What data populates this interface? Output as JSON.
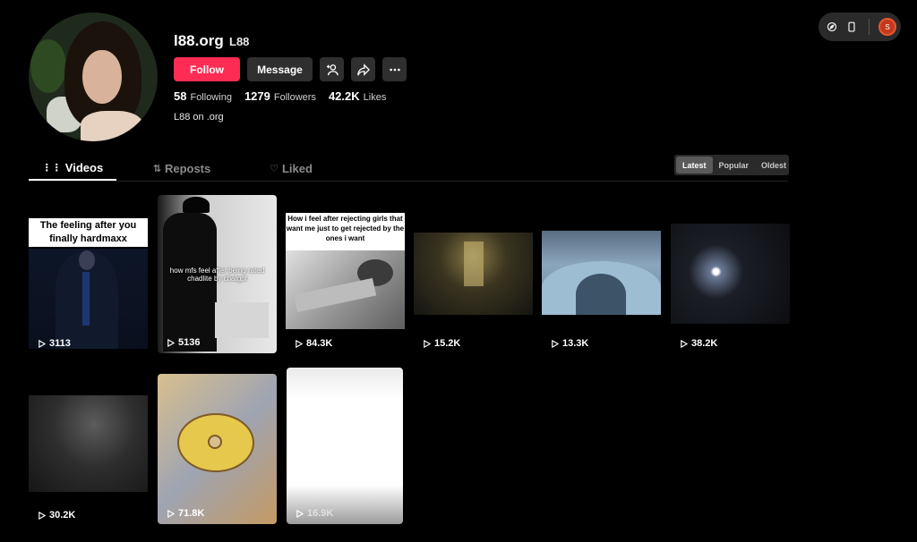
{
  "profile": {
    "handle": "l88.org",
    "nickname": "L88",
    "follow_label": "Follow",
    "message_label": "Message",
    "following_count": "58",
    "following_label": "Following",
    "followers_count": "1279",
    "followers_label": "Followers",
    "likes_count": "42.2K",
    "likes_label": "Likes",
    "bio": "L88 on .org"
  },
  "topbar": {
    "user_initial": "S"
  },
  "tabs": [
    {
      "label": "Videos"
    },
    {
      "label": "Reposts"
    },
    {
      "label": "Liked"
    }
  ],
  "sort": {
    "options": [
      "Latest",
      "Popular",
      "Oldest"
    ],
    "selected": "Latest"
  },
  "videos": [
    {
      "views": "3113",
      "caption": "The feeling after you finally hardmaxx"
    },
    {
      "views": "5136",
      "overlay": "how mfs feel after being rated chadlite by chatgpt"
    },
    {
      "views": "84.3K",
      "caption": "How i feel after rejecting girls that want me just to get rejected by the ones i want"
    },
    {
      "views": "15.2K"
    },
    {
      "views": "13.3K"
    },
    {
      "views": "38.2K"
    },
    {
      "views": "30.2K"
    },
    {
      "views": "71.8K"
    },
    {
      "views": "16.9K"
    }
  ],
  "colors": {
    "accent": "#fe2c55",
    "background": "#000000",
    "button": "#2f2f2f"
  }
}
